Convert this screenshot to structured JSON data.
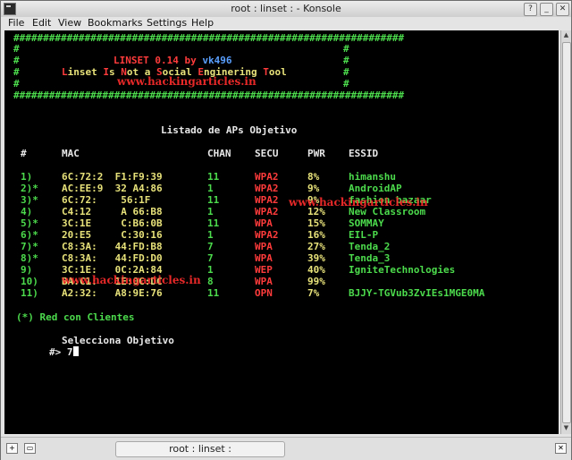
{
  "window": {
    "title": "root : linset : - Konsole",
    "tab_title": "root : linset :"
  },
  "menu": [
    "File",
    "Edit",
    "View",
    "Bookmarks",
    "Settings",
    "Help"
  ],
  "banner": {
    "hash_line": "##################################################################",
    "side": "#",
    "title": "LINSET 0.14 by ",
    "author": "vk496",
    "tagline_parts": [
      {
        "text": "L",
        "c": "red"
      },
      {
        "text": "inset ",
        "c": "yellow"
      },
      {
        "text": "I",
        "c": "red"
      },
      {
        "text": "s ",
        "c": "yellow"
      },
      {
        "text": "N",
        "c": "red"
      },
      {
        "text": "ot a ",
        "c": "yellow"
      },
      {
        "text": "S",
        "c": "red"
      },
      {
        "text": "ocial ",
        "c": "yellow"
      },
      {
        "text": "E",
        "c": "red"
      },
      {
        "text": "nginering ",
        "c": "yellow"
      },
      {
        "text": "T",
        "c": "red"
      },
      {
        "text": "ool",
        "c": "yellow"
      }
    ],
    "watermark": "www.hackingarticles.in"
  },
  "heading": "Listado de APs Objetivo",
  "table": {
    "headers": [
      "#",
      "MAC",
      "CHAN",
      "SECU",
      "PWR",
      "ESSID"
    ],
    "rows": [
      {
        "num": "1)",
        "mac": "6C:72:2  F1:F9:39",
        "chan": "11",
        "secu": "WPA2",
        "pwr": "8%",
        "essid": "himanshu"
      },
      {
        "num": "2)*",
        "mac": "AC:EE:9  32 A4:86",
        "chan": "1",
        "secu": "WPA2",
        "pwr": "9%",
        "essid": "AndroidAP"
      },
      {
        "num": "3)*",
        "mac": "6C:72:    56:1F",
        "chan": "11",
        "secu": "WPA2",
        "pwr": "9%",
        "essid": "fashion bazaar"
      },
      {
        "num": "4)",
        "mac": "C4:12     A 66:B8",
        "chan": "1",
        "secu": "WPA2",
        "pwr": "12%",
        "essid": "New Classroom"
      },
      {
        "num": "5)*",
        "mac": "3C:1E     C:B6:0B",
        "chan": "11",
        "secu": "WPA",
        "pwr": "15%",
        "essid": "SOMMAY"
      },
      {
        "num": "6)*",
        "mac": "20:E5     C:30:16",
        "chan": "1",
        "secu": "WPA2",
        "pwr": "16%",
        "essid": "EIL-P"
      },
      {
        "num": "7)*",
        "mac": "C8:3A:   44:FD:B8",
        "chan": "7",
        "secu": "WPA",
        "pwr": "27%",
        "essid": "Tenda_2"
      },
      {
        "num": "8)*",
        "mac": "C8:3A:   44:FD:D0",
        "chan": "7",
        "secu": "WPA",
        "pwr": "39%",
        "essid": "Tenda_3"
      },
      {
        "num": "9)",
        "mac": "3C:1E:   0C:2A:84",
        "chan": "1",
        "secu": "WEP",
        "pwr": "40%",
        "essid": "IgniteTechnologies"
      },
      {
        "num": "10)",
        "mac": "BA:C1:   1E:0C:DC",
        "chan": "8",
        "secu": "WPA",
        "pwr": "99%",
        "essid": ""
      },
      {
        "num": "11)",
        "mac": "A2:32:   A8:9E:76",
        "chan": "11",
        "secu": "OPN",
        "pwr": "7%",
        "essid": "BJJY-TGVub3ZvIEs1MGE0MA"
      }
    ]
  },
  "legend": "(*) Red con Clientes",
  "prompt_label": "Selecciona Objetivo",
  "prompt": "#> 7",
  "colors": {
    "green": "#4cdb4c",
    "red": "#ff3b3b",
    "yellow": "#e8e27a",
    "blue": "#5aa0ff"
  }
}
